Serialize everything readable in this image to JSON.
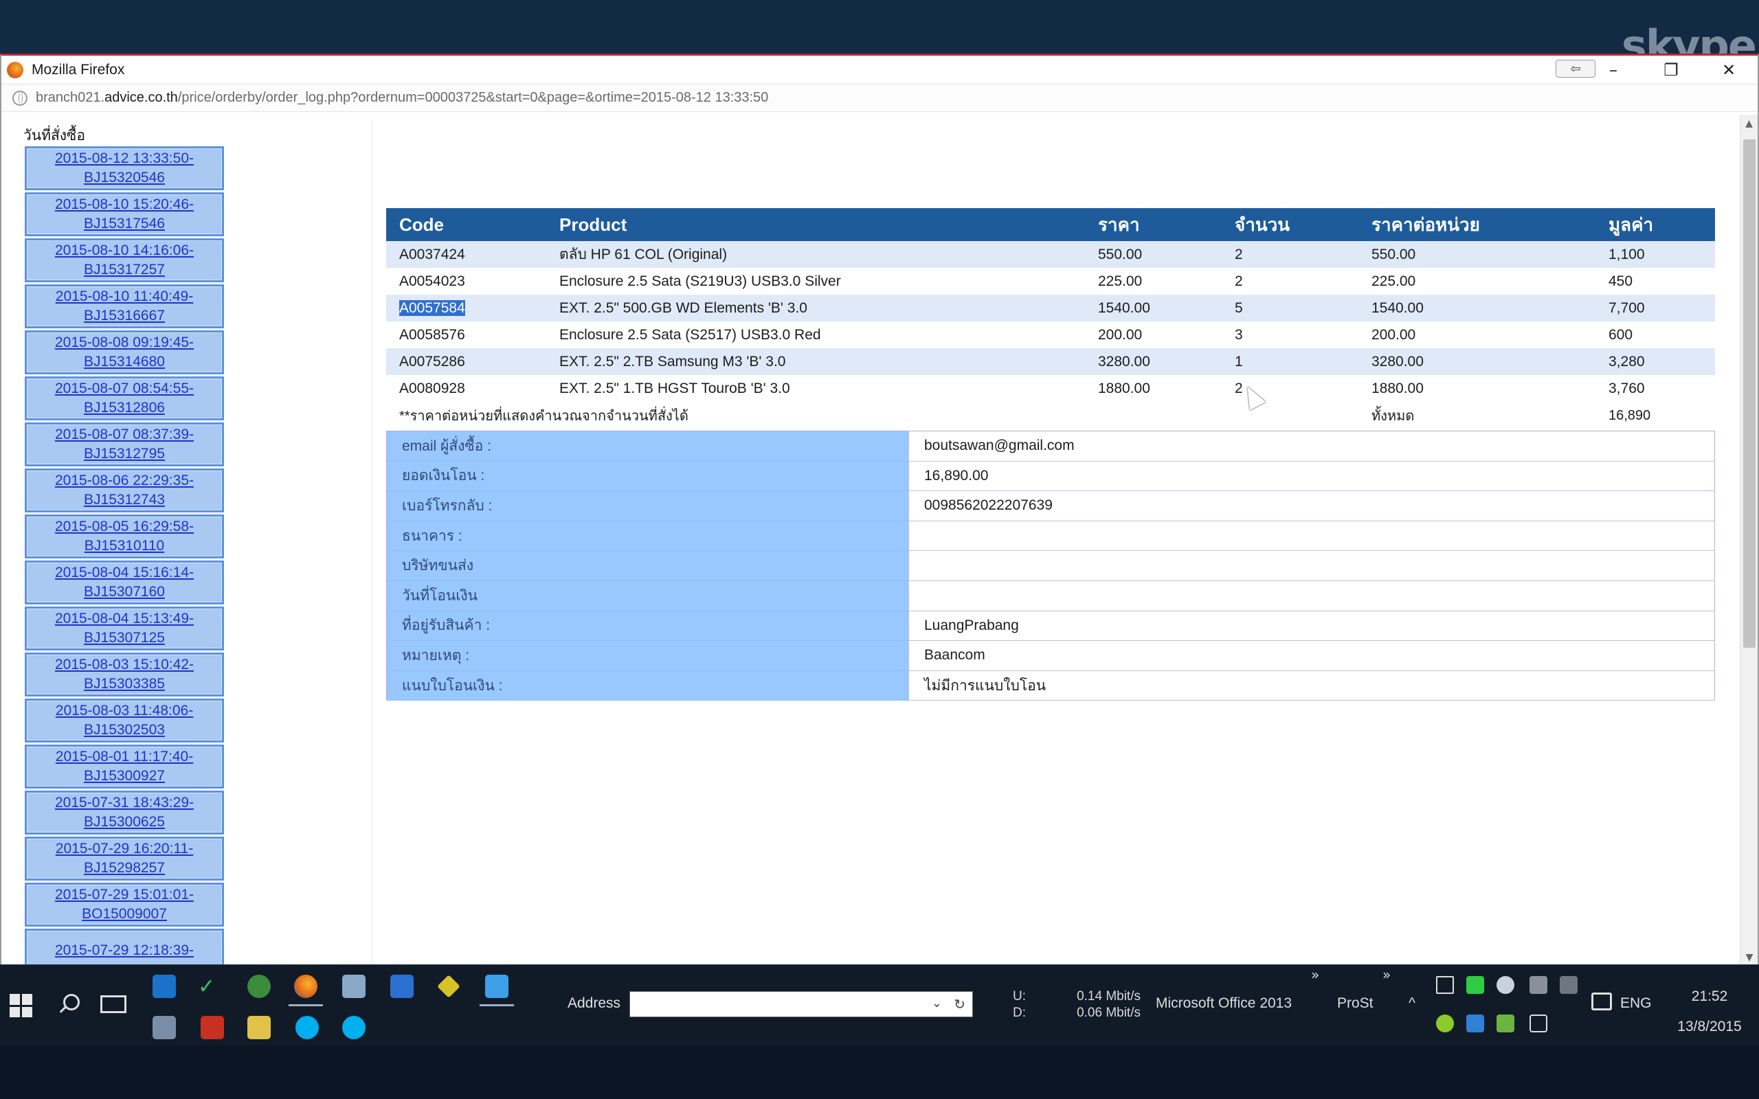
{
  "skype_watermark": "skype",
  "window": {
    "title": "Mozilla Firefox",
    "url_prefix": "branch021.",
    "url_domain": "advice.co.th",
    "url_path": "/price/orderby/order_log.php?ordernum=00003725&start=0&page=&ortime=2015-08-12 13:33:50",
    "back_icon": "⇦",
    "minimize": "–",
    "restore": "❐",
    "close": "✕"
  },
  "sidebar": {
    "title": "วันที่สั่งซื้อ",
    "items": [
      "2015-08-12 13:33:50-BJ15320546",
      "2015-08-10 15:20:46-BJ15317546",
      "2015-08-10 14:16:06-BJ15317257",
      "2015-08-10 11:40:49-BJ15316667",
      "2015-08-08 09:19:45-BJ15314680",
      "2015-08-07 08:54:55-BJ15312806",
      "2015-08-07 08:37:39-BJ15312795",
      "2015-08-06 22:29:35-BJ15312743",
      "2015-08-05 16:29:58-BJ15310110",
      "2015-08-04 15:16:14-BJ15307160",
      "2015-08-04 15:13:49-BJ15307125",
      "2015-08-03 15:10:42-BJ15303385",
      "2015-08-03 11:48:06-BJ15302503",
      "2015-08-01 11:17:40-BJ15300927",
      "2015-07-31 18:43:29-BJ15300625",
      "2015-07-29 16:20:11-BJ15298257",
      "2015-07-29 15:01:01-BO15009007",
      "2015-07-29 12:18:39-"
    ]
  },
  "products": {
    "headers": [
      "Code",
      "Product",
      "ราคา",
      "จำนวน",
      "ราคาต่อหน่วย",
      "มูลค่า"
    ],
    "rows": [
      {
        "code": "A0037424",
        "product": "ตลับ HP 61 COL (Original)",
        "price": "550.00",
        "qty": "2",
        "unit_price": "550.00",
        "value": "1,100"
      },
      {
        "code": "A0054023",
        "product": "Enclosure 2.5 Sata (S219U3) USB3.0 Silver",
        "price": "225.00",
        "qty": "2",
        "unit_price": "225.00",
        "value": "450"
      },
      {
        "code": "A0057584",
        "product": "EXT. 2.5\" 500.GB WD Elements 'B' 3.0",
        "price": "1540.00",
        "qty": "5",
        "unit_price": "1540.00",
        "value": "7,700"
      },
      {
        "code": "A0058576",
        "product": "Enclosure 2.5 Sata (S2517) USB3.0 Red",
        "price": "200.00",
        "qty": "3",
        "unit_price": "200.00",
        "value": "600"
      },
      {
        "code": "A0075286",
        "product": "EXT. 2.5\" 2.TB Samsung M3 'B' 3.0",
        "price": "3280.00",
        "qty": "1",
        "unit_price": "3280.00",
        "value": "3,280"
      },
      {
        "code": "A0080928",
        "product": "EXT. 2.5\" 1.TB HGST TouroB 'B' 3.0",
        "price": "1880.00",
        "qty": "2",
        "unit_price": "1880.00",
        "value": "3,760"
      }
    ],
    "note": "**ราคาต่อหน่วยที่แสดงคำนวณจากจำนวนที่สั่งได้",
    "total_label": "ทั้งหมด",
    "total_value": "16,890"
  },
  "order_info": [
    {
      "label": "email ผู้สั่งซื้อ :",
      "value": "boutsawan@gmail.com"
    },
    {
      "label": "ยอดเงินโอน :",
      "value": "16,890.00"
    },
    {
      "label": "เบอร์โทรกลับ :",
      "value": "0098562022207639"
    },
    {
      "label": "ธนาคาร :",
      "value": ""
    },
    {
      "label": "บริษัทขนส่ง",
      "value": ""
    },
    {
      "label": "วันที่โอนเงิน",
      "value": ""
    },
    {
      "label": "ที่อยู่รับสินค้า :",
      "value": "LuangPrabang"
    },
    {
      "label": "หมายเหตุ :",
      "value": "Baancom"
    },
    {
      "label": "แนบใบโอนเงิน :",
      "value": "ไม่มีการแนบใบโอน"
    }
  ],
  "taskbar": {
    "address_label": "Address",
    "upload_label": "U:",
    "download_label": "D:",
    "upload_speed": "0.14 Mbit/s",
    "download_speed": "0.06 Mbit/s",
    "office_label": "Microsoft Office 2013",
    "prost_label": "ProSt",
    "chevron": "»",
    "tray_up": "^",
    "language": "ENG",
    "time": "21:52",
    "date": "13/8/2015"
  }
}
